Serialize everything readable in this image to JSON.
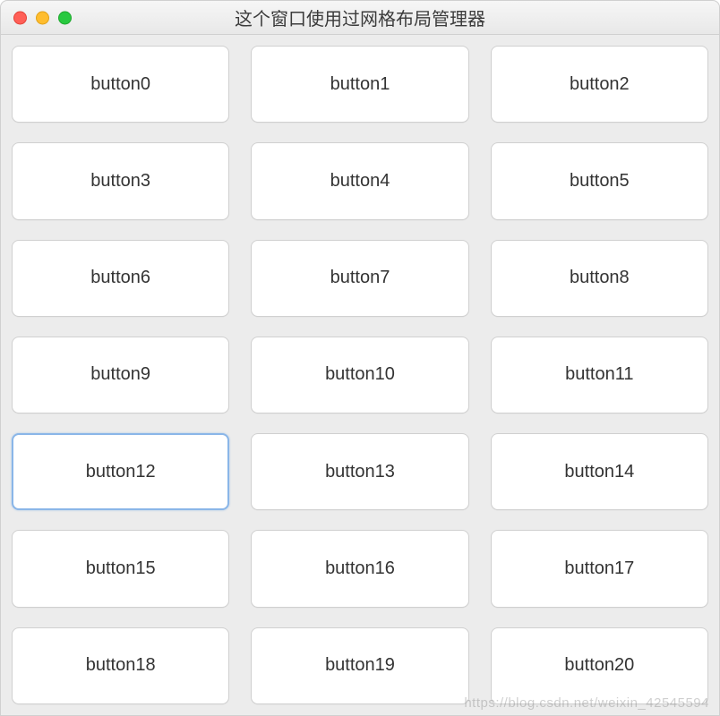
{
  "window": {
    "title": "这个窗口使用过网格布局管理器"
  },
  "grid": {
    "buttons": [
      {
        "label": "button0"
      },
      {
        "label": "button1"
      },
      {
        "label": "button2"
      },
      {
        "label": "button3"
      },
      {
        "label": "button4"
      },
      {
        "label": "button5"
      },
      {
        "label": "button6"
      },
      {
        "label": "button7"
      },
      {
        "label": "button8"
      },
      {
        "label": "button9"
      },
      {
        "label": "button10"
      },
      {
        "label": "button11"
      },
      {
        "label": "button12",
        "focused": true
      },
      {
        "label": "button13"
      },
      {
        "label": "button14"
      },
      {
        "label": "button15"
      },
      {
        "label": "button16"
      },
      {
        "label": "button17"
      },
      {
        "label": "button18"
      },
      {
        "label": "button19"
      },
      {
        "label": "button20"
      }
    ]
  },
  "watermark": {
    "text": "https://blog.csdn.net/weixin_42545594"
  }
}
